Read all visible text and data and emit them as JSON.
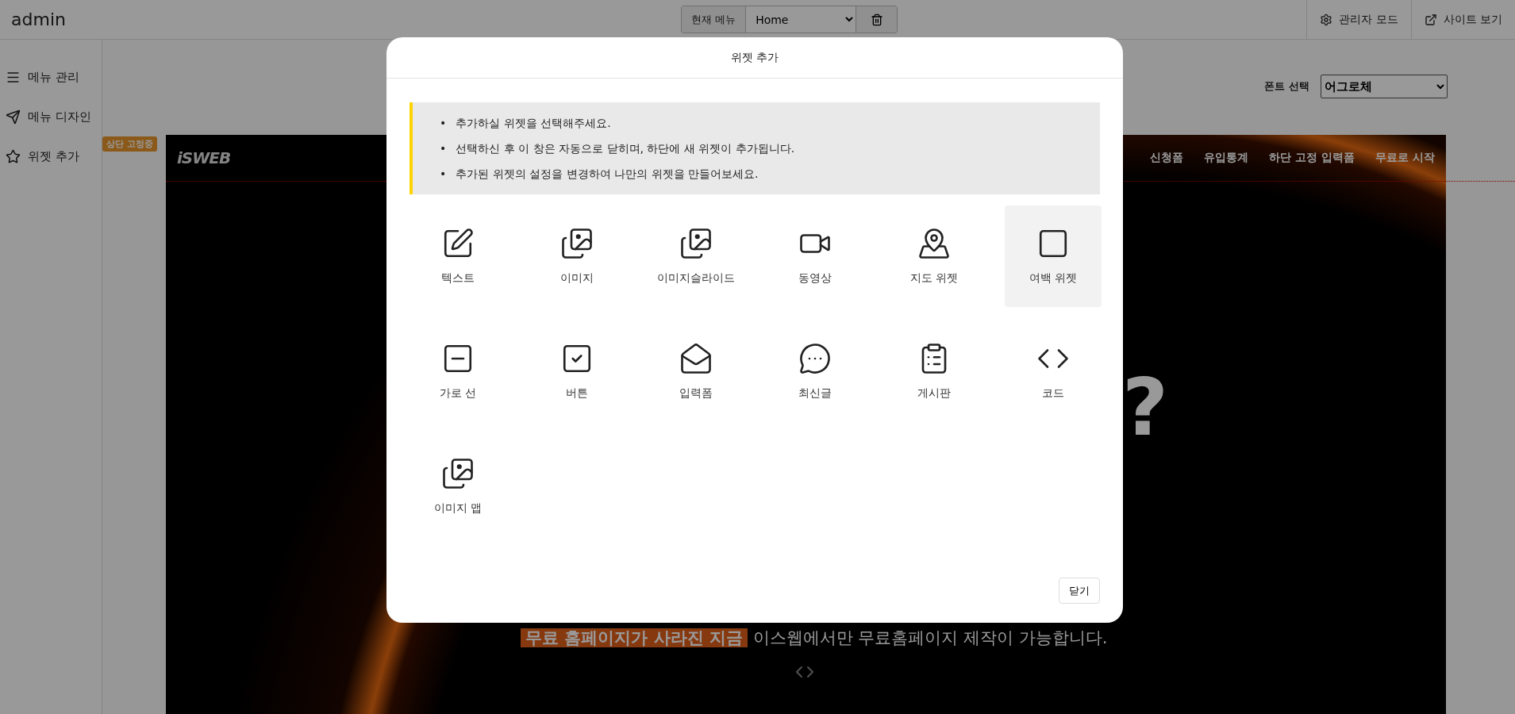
{
  "topbar": {
    "brand": "admin",
    "current_menu_label": "현재 메뉴",
    "current_menu_value": "Home",
    "actions": [
      {
        "label": "관리자 모드",
        "kind": "settings"
      },
      {
        "label": "사이트 보기",
        "kind": "external"
      }
    ]
  },
  "sidebar": {
    "items": [
      {
        "label": "메뉴 관리",
        "kind": "menu"
      },
      {
        "label": "메뉴 디자인",
        "kind": "send"
      },
      {
        "label": "위젯 추가",
        "kind": "star"
      }
    ]
  },
  "font_select": {
    "label": "폰트 선택",
    "value": "어그로체"
  },
  "site": {
    "badge": "상단 고정중",
    "logo": "iSWEB",
    "nav": [
      "신청폼",
      "유입통계",
      "하단 고정 입력폼",
      "무료로 시작"
    ],
    "hero_mark": "?",
    "tagline_highlight": "무료 홈페이지가 사라진 지금",
    "tagline": "이스웹에서만 무료홈페이지 제작이 가능합니다."
  },
  "modal": {
    "title": "위젯 추가",
    "bullet": "•",
    "notes": [
      "추가하실 위젯을 선택해주세요.",
      "선택하신 후 이 창은 자동으로 닫히며, 하단에 새 위젯이 추가됩니다.",
      "추가된 위젯의 설정을 변경하여 나만의 위젯을 만들어보세요."
    ],
    "widgets": [
      {
        "label": "텍스트",
        "kind": "text",
        "selected": false
      },
      {
        "label": "이미지",
        "kind": "image",
        "selected": false
      },
      {
        "label": "이미지슬라이드",
        "kind": "slider",
        "selected": false
      },
      {
        "label": "동영상",
        "kind": "video",
        "selected": false
      },
      {
        "label": "지도 위젯",
        "kind": "map",
        "selected": false
      },
      {
        "label": "여백 위젯",
        "kind": "spacer",
        "selected": true
      },
      {
        "label": "가로 선",
        "kind": "divider",
        "selected": false
      },
      {
        "label": "버튼",
        "kind": "button",
        "selected": false
      },
      {
        "label": "입력폼",
        "kind": "form",
        "selected": false
      },
      {
        "label": "최신글",
        "kind": "posts",
        "selected": false
      },
      {
        "label": "게시판",
        "kind": "board",
        "selected": false
      },
      {
        "label": "코드",
        "kind": "code",
        "selected": false
      },
      {
        "label": "이미지 맵",
        "kind": "imagemap",
        "selected": false
      }
    ],
    "close_button": "닫기"
  }
}
